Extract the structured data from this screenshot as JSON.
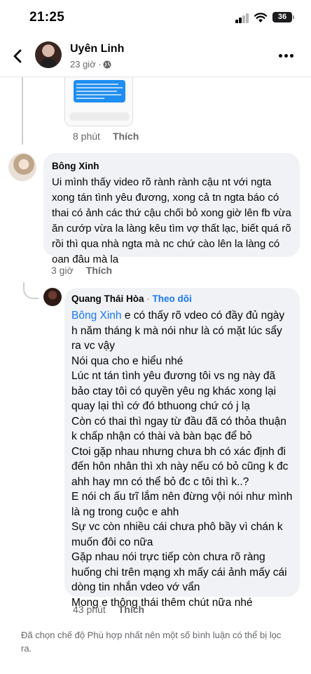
{
  "status_bar": {
    "time": "21:25",
    "battery": "36"
  },
  "header": {
    "name": "Uyên Linh",
    "time": "23 giờ ·"
  },
  "previous": {
    "time": "8 phút",
    "like": "Thích"
  },
  "comment": {
    "author": "Bông Xinh",
    "text": "Ui mình thấy video rõ rành rành cậu nt với ngta xong tán tình yêu đương, xong cả tn ngta báo có thai có ảnh các thứ cậu chối bỏ xong giờ lên fb vừa ăn cướp vừa la làng kêu tìm vợ thất lạc, biết quá rõ rồi thì qua nhà ngta mà nc chứ cào lên la làng có oan đâu mà la",
    "time": "3 giờ",
    "like": "Thích"
  },
  "reply": {
    "author": "Quang Thái Hòa",
    "separator": " · ",
    "follow": "Theo dõi",
    "mention": "Bông Xinh",
    "text": " e có thấy rõ vdeo có đầy đủ ngày h năm tháng k mà nói như là có mặt lúc sẩy ra vc vậy\nNói qua cho e hiểu nhé\nLúc nt tán tình yêu đương tôi vs ng này đã bảo ctay tôi có quyền yêu ng khác xong lại quay lại thì cớ đó bthuong chứ có j lạ\nCòn có thai thì ngay từ đầu đã có thỏa thuận k chấp nhận có thài và bàn bạc để bỏ\nCtoi gặp nhau nhưng chưa bh có xác định đi đến hôn nhân thì xh này nếu có bỏ cũng k đc ahh hay mn có thể bỏ đc c tôi thì k..?\nE nói ch ấu trĩ lắm nên đừng vội nói như mình là ng trong cuộc e ahh\nSự vc còn nhiều cái chưa phô bầy vì chán k muốn đôi co nữa\nGặp nhau nói trực tiếp còn chưa rõ ràng huống chi trên mạng xh mấy cái ảnh mấy cái dòng tin nhắn vdeo vớ vẩn\nMong e thông thái thêm chút nữa nhé",
    "time": "43 phút",
    "like": "Thích"
  },
  "footer_note": "Đã chọn chế độ Phù hợp nhất nên một số bình luận có thể bị lọc ra."
}
